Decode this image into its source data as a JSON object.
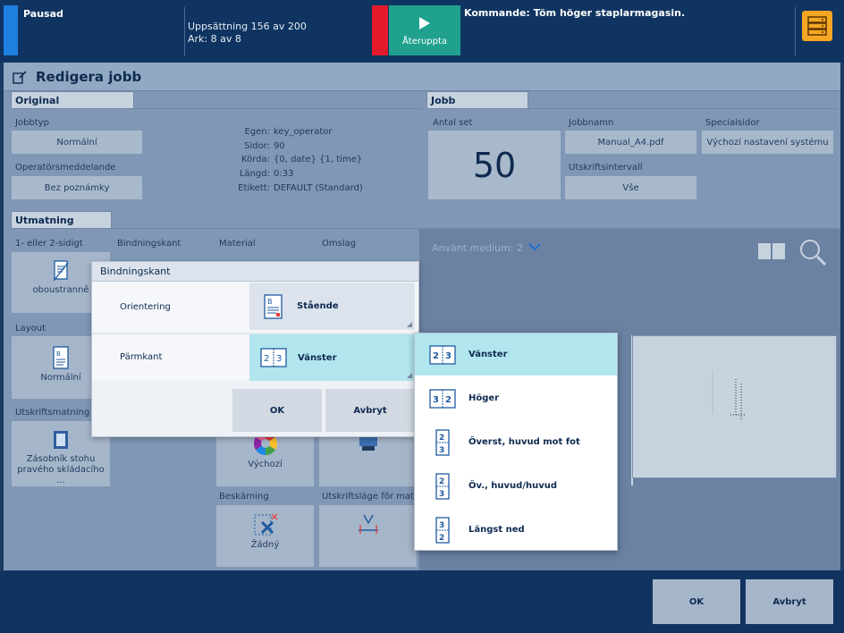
{
  "status": {
    "state": "Pausad",
    "set_progress": "Uppsättning 156 av 200",
    "sheet_progress": "Ark: 8 av 8",
    "resume_label": "Återuppta",
    "command": "Kommande: Töm höger staplarmagasin."
  },
  "window": {
    "title": "Redigera jobb"
  },
  "original": {
    "tab": "Original",
    "jobtype_label": "Jobbtyp",
    "jobtype_value": "Normální",
    "operator_msg_label": "Operatörsmeddelande",
    "operator_msg_value": "Bez poznámky",
    "info": [
      {
        "k": "Egen:",
        "v": "key_operator"
      },
      {
        "k": "Sidor:",
        "v": "90"
      },
      {
        "k": "Körda:",
        "v": "{0, date} {1, time}"
      },
      {
        "k": "Längd:",
        "v": "0:33"
      },
      {
        "k": "Etikett:",
        "v": "DEFAULT (Standard)"
      }
    ]
  },
  "jobb": {
    "tab": "Jobb",
    "sets_label": "Antal set",
    "sets_value": "50",
    "jobname_label": "Jobbnamn",
    "jobname_value": "Manual_A4.pdf",
    "special_label": "Specialsidor",
    "special_value": "Výchozí nastavení systému",
    "interval_label": "Utskriftsintervall",
    "interval_value": "Vše"
  },
  "utmatning": {
    "tab": "Utmatning",
    "sides_label": "1- eller 2-sidigt",
    "sides_value": "oboustranně",
    "binding_label": "Bindningskant",
    "material_label": "Material",
    "cover_label": "Omslag",
    "layout_label": "Layout",
    "layout_value": "Normální",
    "output_label": "Utskriftsmatning",
    "output_value": "Zásobník stohu pravého skládacího ...",
    "color_value": "Výchozí",
    "trim_label": "Beskärning",
    "trim_value": "Žádný",
    "printmode_label": "Utskriftsläge för mat...",
    "media_used": "Använt medium: 2"
  },
  "dialog": {
    "title": "Bindningskant",
    "orientation_label": "Orientering",
    "orientation_value": "Stående",
    "edge_label": "Pärmkant",
    "edge_value": "Vänster",
    "ok": "OK",
    "cancel": "Avbryt"
  },
  "dropdown": {
    "items": [
      {
        "label": "Vänster",
        "selected": true
      },
      {
        "label": "Höger",
        "selected": false
      },
      {
        "label": "Överst, huvud mot fot",
        "selected": false
      },
      {
        "label": "Öv., huvud/huvud",
        "selected": false
      },
      {
        "label": "Längst ned",
        "selected": false
      }
    ]
  },
  "footer": {
    "ok": "OK",
    "cancel": "Avbryt"
  },
  "colors": {
    "accent": "#1fa18e",
    "alert": "#e21a2a",
    "selected": "#b2e6ee"
  }
}
